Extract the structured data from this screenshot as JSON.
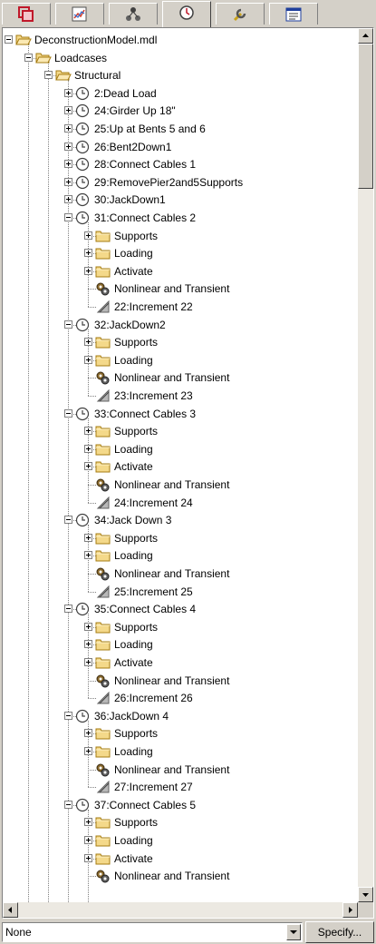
{
  "tabs": [
    {
      "icon": "layers-icon",
      "active": false
    },
    {
      "icon": "chart-icon",
      "active": false
    },
    {
      "icon": "network-icon",
      "active": false
    },
    {
      "icon": "clock-icon",
      "active": true
    },
    {
      "icon": "wrench-icon",
      "active": false
    },
    {
      "icon": "list-window-icon",
      "active": false
    }
  ],
  "tree": [
    {
      "label": "DeconstructionModel.mdl",
      "depth": 0,
      "icon": "folder-open",
      "exp": "minus"
    },
    {
      "label": "Loadcases",
      "depth": 1,
      "icon": "folder-open",
      "exp": "minus"
    },
    {
      "label": "Structural",
      "depth": 2,
      "icon": "folder-open",
      "exp": "minus"
    },
    {
      "label": "2:Dead Load",
      "depth": 3,
      "icon": "clock",
      "exp": "plus"
    },
    {
      "label": "24:Girder Up 18\"",
      "depth": 3,
      "icon": "clock",
      "exp": "plus"
    },
    {
      "label": "25:Up at Bents 5 and 6",
      "depth": 3,
      "icon": "clock",
      "exp": "plus"
    },
    {
      "label": "26:Bent2Down1",
      "depth": 3,
      "icon": "clock",
      "exp": "plus"
    },
    {
      "label": "28:Connect Cables 1",
      "depth": 3,
      "icon": "clock",
      "exp": "plus"
    },
    {
      "label": "29:RemovePier2and5Supports",
      "depth": 3,
      "icon": "clock",
      "exp": "plus"
    },
    {
      "label": "30:JackDown1",
      "depth": 3,
      "icon": "clock",
      "exp": "plus"
    },
    {
      "label": "31:Connect Cables 2",
      "depth": 3,
      "icon": "clock",
      "exp": "minus"
    },
    {
      "label": "Supports",
      "depth": 4,
      "icon": "folder",
      "exp": "plus"
    },
    {
      "label": "Loading",
      "depth": 4,
      "icon": "folder",
      "exp": "plus"
    },
    {
      "label": "Activate",
      "depth": 4,
      "icon": "folder",
      "exp": "plus"
    },
    {
      "label": "Nonlinear and Transient",
      "depth": 4,
      "icon": "gears",
      "exp": "none"
    },
    {
      "label": "22:Increment 22",
      "depth": 4,
      "icon": "increment",
      "exp": "none"
    },
    {
      "label": "32:JackDown2",
      "depth": 3,
      "icon": "clock",
      "exp": "minus"
    },
    {
      "label": "Supports",
      "depth": 4,
      "icon": "folder",
      "exp": "plus"
    },
    {
      "label": "Loading",
      "depth": 4,
      "icon": "folder",
      "exp": "plus"
    },
    {
      "label": "Nonlinear and Transient",
      "depth": 4,
      "icon": "gears",
      "exp": "none"
    },
    {
      "label": "23:Increment 23",
      "depth": 4,
      "icon": "increment",
      "exp": "none"
    },
    {
      "label": "33:Connect Cables 3",
      "depth": 3,
      "icon": "clock",
      "exp": "minus"
    },
    {
      "label": "Supports",
      "depth": 4,
      "icon": "folder",
      "exp": "plus"
    },
    {
      "label": "Loading",
      "depth": 4,
      "icon": "folder",
      "exp": "plus"
    },
    {
      "label": "Activate",
      "depth": 4,
      "icon": "folder",
      "exp": "plus"
    },
    {
      "label": "Nonlinear and Transient",
      "depth": 4,
      "icon": "gears",
      "exp": "none"
    },
    {
      "label": "24:Increment 24",
      "depth": 4,
      "icon": "increment",
      "exp": "none"
    },
    {
      "label": "34:Jack Down 3",
      "depth": 3,
      "icon": "clock",
      "exp": "minus"
    },
    {
      "label": "Supports",
      "depth": 4,
      "icon": "folder",
      "exp": "plus"
    },
    {
      "label": "Loading",
      "depth": 4,
      "icon": "folder",
      "exp": "plus"
    },
    {
      "label": "Nonlinear and Transient",
      "depth": 4,
      "icon": "gears",
      "exp": "none"
    },
    {
      "label": "25:Increment 25",
      "depth": 4,
      "icon": "increment",
      "exp": "none"
    },
    {
      "label": "35:Connect Cables 4",
      "depth": 3,
      "icon": "clock",
      "exp": "minus"
    },
    {
      "label": "Supports",
      "depth": 4,
      "icon": "folder",
      "exp": "plus"
    },
    {
      "label": "Loading",
      "depth": 4,
      "icon": "folder",
      "exp": "plus"
    },
    {
      "label": "Activate",
      "depth": 4,
      "icon": "folder",
      "exp": "plus"
    },
    {
      "label": "Nonlinear and Transient",
      "depth": 4,
      "icon": "gears",
      "exp": "none"
    },
    {
      "label": "26:Increment 26",
      "depth": 4,
      "icon": "increment",
      "exp": "none"
    },
    {
      "label": "36:JackDown 4",
      "depth": 3,
      "icon": "clock",
      "exp": "minus"
    },
    {
      "label": "Supports",
      "depth": 4,
      "icon": "folder",
      "exp": "plus"
    },
    {
      "label": "Loading",
      "depth": 4,
      "icon": "folder",
      "exp": "plus"
    },
    {
      "label": "Nonlinear and Transient",
      "depth": 4,
      "icon": "gears",
      "exp": "none"
    },
    {
      "label": "27:Increment 27",
      "depth": 4,
      "icon": "increment",
      "exp": "none"
    },
    {
      "label": "37:Connect Cables 5",
      "depth": 3,
      "icon": "clock",
      "exp": "minus"
    },
    {
      "label": "Supports",
      "depth": 4,
      "icon": "folder",
      "exp": "plus"
    },
    {
      "label": "Loading",
      "depth": 4,
      "icon": "folder",
      "exp": "plus"
    },
    {
      "label": "Activate",
      "depth": 4,
      "icon": "folder",
      "exp": "plus"
    },
    {
      "label": "Nonlinear and Transient",
      "depth": 4,
      "icon": "gears",
      "exp": "none"
    }
  ],
  "bottom": {
    "combo_value": "None",
    "specify_label": "Specify..."
  },
  "colors": {
    "folder": "#f4d98a",
    "folder_edge": "#a67c12",
    "clock": "#ffffff",
    "tab_icon_red": "#c0182a",
    "face": "#d4d0c8"
  }
}
